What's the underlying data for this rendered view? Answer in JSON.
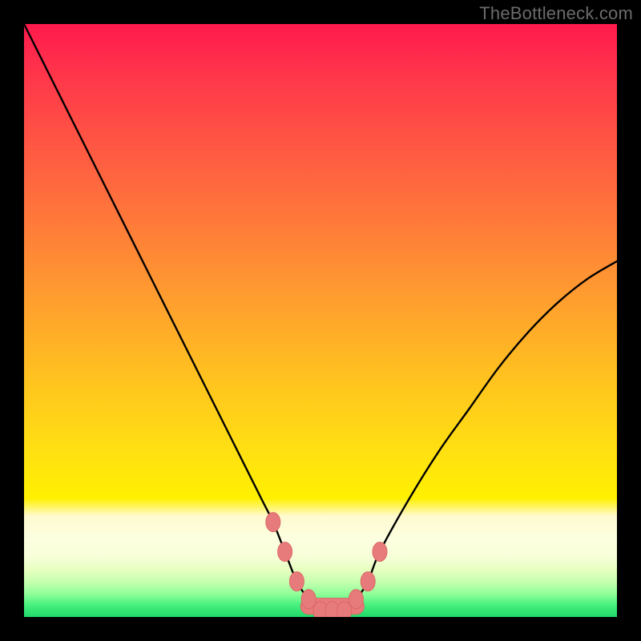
{
  "attribution": "TheBottleneck.com",
  "colors": {
    "frame": "#000000",
    "curve_stroke": "#000000",
    "marker_fill": "#e77b7b",
    "marker_stroke": "#d66",
    "gradient_top": "#ff1a4d",
    "gradient_mid": "#ffe012",
    "gradient_bottom": "#1fd868"
  },
  "chart_data": {
    "type": "line",
    "title": "",
    "xlabel": "",
    "ylabel": "",
    "xlim": [
      0,
      100
    ],
    "ylim": [
      0,
      100
    ],
    "grid": false,
    "legend": false,
    "series": [
      {
        "name": "bottleneck-curve",
        "x": [
          0,
          5,
          10,
          15,
          20,
          25,
          30,
          35,
          40,
          42,
          44,
          46,
          48,
          50,
          52,
          54,
          56,
          58,
          60,
          65,
          70,
          75,
          80,
          85,
          90,
          95,
          100
        ],
        "values": [
          100,
          90,
          80,
          70,
          60,
          50,
          40,
          30,
          20,
          16,
          11,
          6,
          3,
          1,
          1,
          1,
          3,
          6,
          11,
          20,
          28,
          35,
          42,
          48,
          53,
          57,
          60
        ]
      }
    ],
    "markers": {
      "name": "highlight-points",
      "x": [
        42,
        44,
        46,
        48,
        50,
        52,
        54,
        56,
        58,
        60
      ],
      "values": [
        16,
        11,
        6,
        3,
        1,
        1,
        1,
        3,
        6,
        11
      ]
    }
  }
}
